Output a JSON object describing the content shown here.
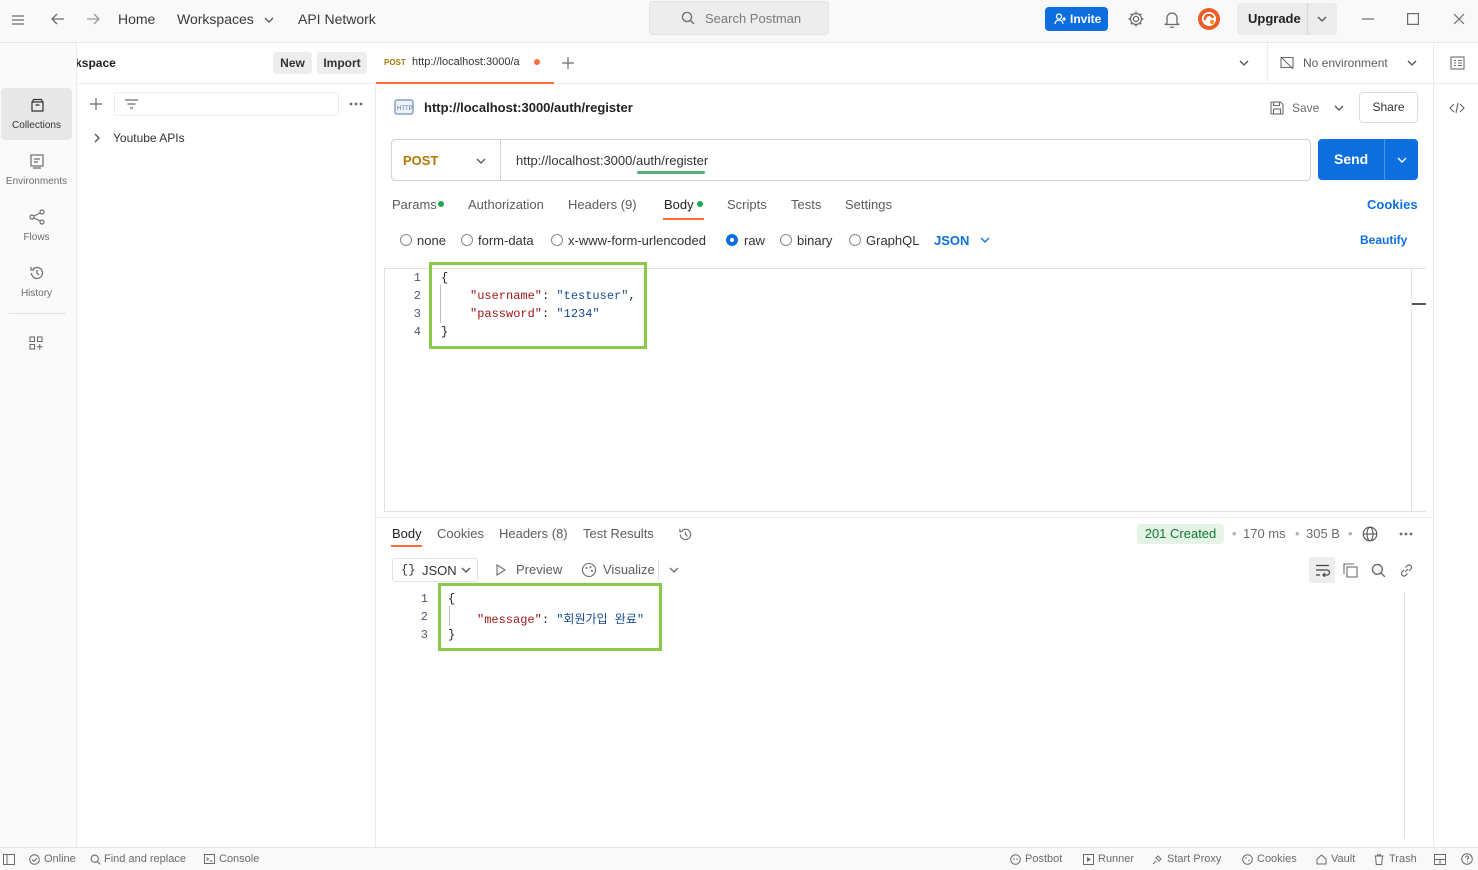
{
  "topbar": {
    "home": "Home",
    "workspaces": "Workspaces",
    "api_network": "API Network",
    "search_placeholder": "Search Postman",
    "invite": "Invite",
    "upgrade": "Upgrade"
  },
  "sidebar": {
    "workspace_name": "My Workspace",
    "new_button": "New",
    "import_button": "Import",
    "rail": [
      {
        "label": "Collections",
        "icon": "collections-icon"
      },
      {
        "label": "Environments",
        "icon": "environments-icon"
      },
      {
        "label": "Flows",
        "icon": "flows-icon"
      },
      {
        "label": "History",
        "icon": "history-icon"
      }
    ],
    "collections": [
      {
        "name": "Youtube APIs"
      }
    ]
  },
  "tabs": {
    "open_tab": {
      "method": "POST",
      "title": "http://localhost:3000/a"
    },
    "environment": "No environment"
  },
  "request": {
    "title": "http://localhost:3000/auth/register",
    "save": "Save",
    "share": "Share",
    "method": "POST",
    "url": "http://localhost:3000/auth/register",
    "send": "Send",
    "tabs": [
      "Params",
      "Authorization",
      "Headers (9)",
      "Body",
      "Scripts",
      "Tests",
      "Settings"
    ],
    "active_tab": "Body",
    "cookies": "Cookies",
    "body_types": [
      "none",
      "form-data",
      "x-www-form-urlencoded",
      "raw",
      "binary",
      "GraphQL"
    ],
    "selected_body_type": "raw",
    "format": "JSON",
    "beautify": "Beautify",
    "body_lines": [
      {
        "n": "1",
        "text": "{"
      },
      {
        "n": "2",
        "key": "\"username\"",
        "sep": ": ",
        "val": "\"testuser\"",
        "end": ","
      },
      {
        "n": "3",
        "key": "\"password\"",
        "sep": ": ",
        "val": "\"1234\"",
        "end": ""
      },
      {
        "n": "4",
        "text": "}"
      }
    ]
  },
  "response": {
    "tabs": [
      "Body",
      "Cookies",
      "Headers (8)",
      "Test Results"
    ],
    "active_tab": "Body",
    "status": "201 Created",
    "time": "170 ms",
    "size": "305 B",
    "format": "JSON",
    "preview": "Preview",
    "visualize": "Visualize",
    "body_lines": [
      {
        "n": "1",
        "text": "{"
      },
      {
        "n": "2",
        "key": "\"message\"",
        "sep": ": ",
        "val": "\"회원가입 완료\"",
        "end": ""
      },
      {
        "n": "3",
        "text": "}"
      }
    ]
  },
  "statusbar": {
    "online": "Online",
    "find_replace": "Find and replace",
    "console": "Console",
    "postbot": "Postbot",
    "runner": "Runner",
    "start_proxy": "Start Proxy",
    "cookies": "Cookies",
    "vault": "Vault",
    "trash": "Trash"
  },
  "colors": {
    "accent": "#0d6fde",
    "brand": "#ff6c37",
    "status_green": "#0f7a2e",
    "highlight": "#8bc94a",
    "method_post": "#ad7a03"
  }
}
